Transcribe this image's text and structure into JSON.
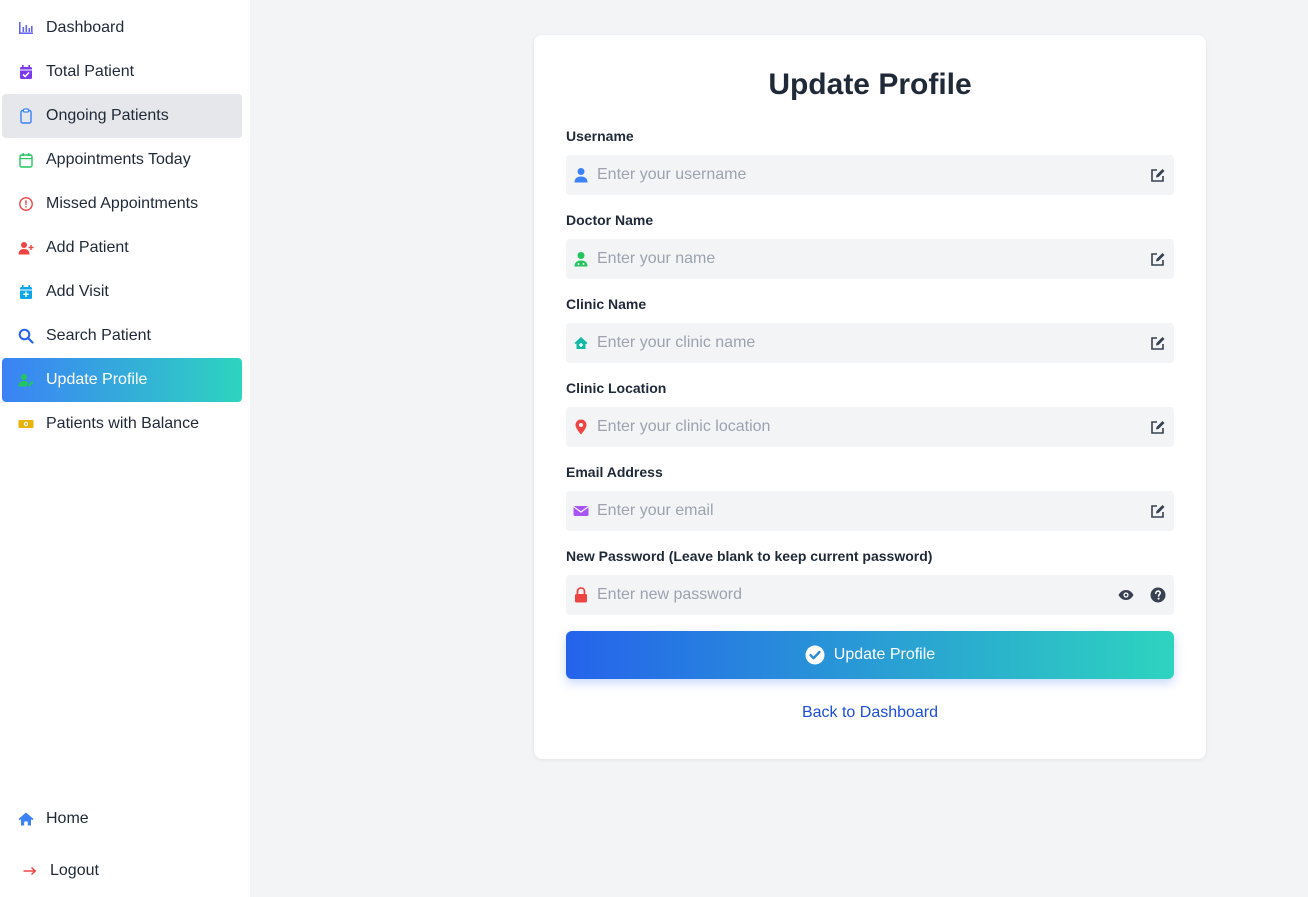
{
  "sidebar": {
    "items": [
      {
        "label": "Dashboard",
        "icon": "chart-icon",
        "color": "#6366f1"
      },
      {
        "label": "Total Patient",
        "icon": "calendar-check-icon",
        "color": "#7c3aed"
      },
      {
        "label": "Ongoing Patients",
        "icon": "clipboard-icon",
        "color": "#3b82f6"
      },
      {
        "label": "Appointments Today",
        "icon": "calendar-icon",
        "color": "#22c55e"
      },
      {
        "label": "Missed Appointments",
        "icon": "alert-circle-icon",
        "color": "#ef4444"
      },
      {
        "label": "Add Patient",
        "icon": "user-plus-icon",
        "color": "#ef4444"
      },
      {
        "label": "Add Visit",
        "icon": "calendar-plus-icon",
        "color": "#0ea5e9"
      },
      {
        "label": "Search Patient",
        "icon": "search-icon",
        "color": "#2563eb"
      },
      {
        "label": "Update Profile",
        "icon": "user-edit-icon",
        "color": "#22c55e"
      },
      {
        "label": "Patients with Balance",
        "icon": "money-bill-icon",
        "color": "#eab308"
      }
    ],
    "home_label": "Home",
    "logout_label": "Logout"
  },
  "form": {
    "title": "Update Profile",
    "fields": [
      {
        "label": "Username",
        "placeholder": "Enter your username",
        "icon": "user-icon"
      },
      {
        "label": "Doctor Name",
        "placeholder": "Enter your name",
        "icon": "user-doctor-icon"
      },
      {
        "label": "Clinic Name",
        "placeholder": "Enter your clinic name",
        "icon": "clinic-icon"
      },
      {
        "label": "Clinic Location",
        "placeholder": "Enter your clinic location",
        "icon": "map-pin-icon"
      },
      {
        "label": "Email Address",
        "placeholder": "Enter your email",
        "icon": "envelope-icon"
      },
      {
        "label": "New Password (Leave blank to keep current password)",
        "placeholder": "Enter new password",
        "icon": "lock-icon"
      }
    ],
    "submit_label": "Update Profile",
    "back_label": "Back to Dashboard"
  },
  "colors": {
    "accent_start": "#2563eb",
    "accent_end": "#2dd4bf",
    "link": "#1d4ed8",
    "active_item_start": "#3b82f6"
  }
}
